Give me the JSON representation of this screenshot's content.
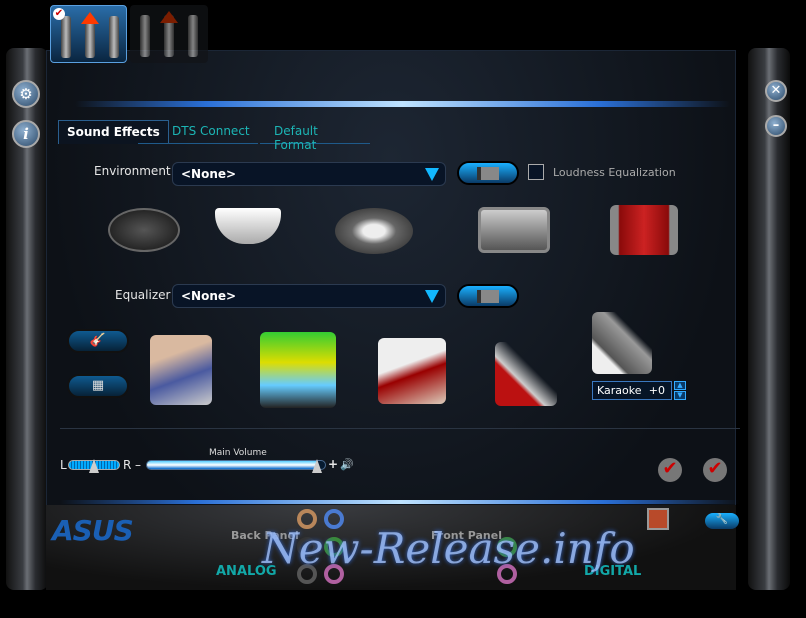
{
  "devices": [
    {
      "name": "analog-device",
      "selected": true
    },
    {
      "name": "digital-device",
      "selected": false
    }
  ],
  "tabs": [
    {
      "label": "Sound Effects",
      "active": true
    },
    {
      "label": "DTS Connect",
      "active": false
    },
    {
      "label": "Default Format",
      "active": false
    }
  ],
  "environment": {
    "label": "Environment",
    "value": "<None>",
    "loudness_label": "Loudness Equalization",
    "loudness_checked": false
  },
  "equalizer": {
    "label": "Equalizer",
    "value": "<None>"
  },
  "karaoke": {
    "label": "Karaoke",
    "value": "+0"
  },
  "volume": {
    "title": "Main Volume",
    "left": "L",
    "right": "R",
    "minus": "–",
    "plus": "+",
    "level": 95,
    "balance": 50
  },
  "bottom": {
    "brand": "ASUS",
    "back_panel": "Back Panel",
    "front_panel": "Front Panel",
    "analog": "ANALOG",
    "digital": "DIGITAL"
  },
  "watermark": "New-Release.info",
  "colors": {
    "accent": "#12b8ff",
    "teal": "#12a8a8",
    "brand": "#1a5fb4"
  }
}
